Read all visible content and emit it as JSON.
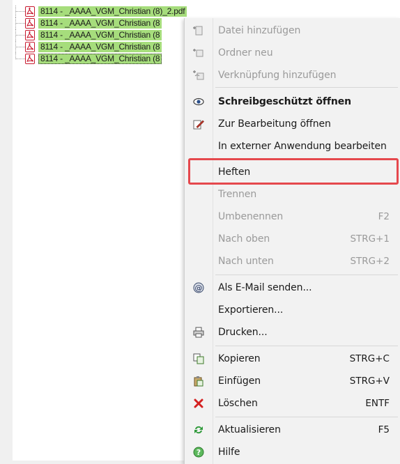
{
  "tree": {
    "files": [
      {
        "name": "8114 - _AAAA_VGM_Christian (8)_2.pdf"
      },
      {
        "name": "8114 - _AAAA_VGM_Christian (8"
      },
      {
        "name": "8114 - _AAAA_VGM_Christian (8"
      },
      {
        "name": "8114 - _AAAA_VGM_Christian (8"
      },
      {
        "name": "8114 - _AAAA_VGM_Christian (8"
      }
    ]
  },
  "menu": {
    "items": [
      {
        "label": "Datei hinzufügen",
        "icon": "add-file-icon",
        "disabled": true
      },
      {
        "label": "Ordner neu",
        "icon": "new-folder-icon",
        "disabled": true
      },
      {
        "label": "Verknüpfung hinzufügen",
        "icon": "add-link-icon",
        "disabled": true
      },
      {
        "label": "Schreibgeschützt öffnen",
        "icon": "eye-icon",
        "bold": true
      },
      {
        "label": "Zur Bearbeitung öffnen",
        "icon": "edit-icon"
      },
      {
        "label": "In externer Anwendung bearbeiten"
      },
      {
        "label": "Heften",
        "highlighted": true
      },
      {
        "label": "Trennen",
        "disabled": true
      },
      {
        "label": "Umbenennen",
        "shortcut": "F2",
        "disabled": true
      },
      {
        "label": "Nach oben",
        "shortcut": "STRG+1",
        "disabled": true
      },
      {
        "label": "Nach unten",
        "shortcut": "STRG+2",
        "disabled": true
      },
      {
        "label": "Als E-Mail senden...",
        "icon": "email-at-icon"
      },
      {
        "label": "Exportieren..."
      },
      {
        "label": "Drucken...",
        "icon": "print-icon"
      },
      {
        "label": "Kopieren",
        "shortcut": "STRG+C",
        "icon": "copy-icon"
      },
      {
        "label": "Einfügen",
        "shortcut": "STRG+V",
        "icon": "paste-icon"
      },
      {
        "label": "Löschen",
        "shortcut": "ENTF",
        "icon": "delete-x-icon"
      },
      {
        "label": "Aktualisieren",
        "shortcut": "F5",
        "icon": "refresh-icon"
      },
      {
        "label": "Hilfe",
        "icon": "help-icon"
      }
    ]
  },
  "colors": {
    "selection": "#a6dd7c",
    "highlight_box": "#e5484d",
    "pdf_red": "#c8192e"
  }
}
